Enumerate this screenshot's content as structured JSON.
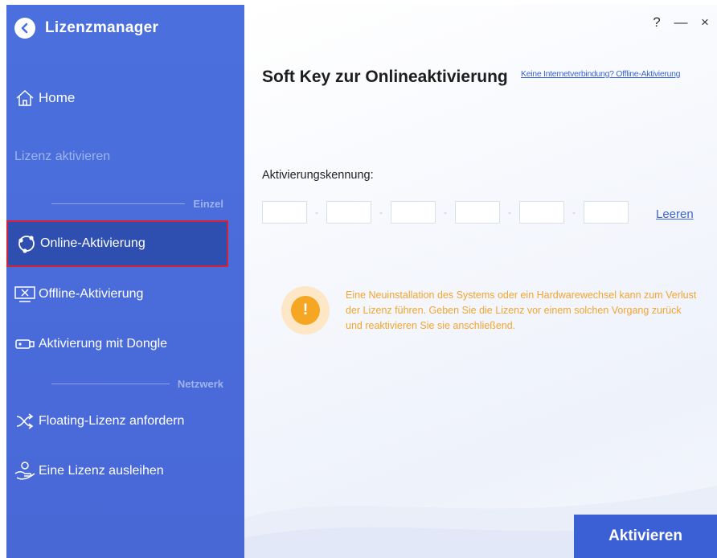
{
  "app": {
    "title": "Lizenzmanager"
  },
  "window_controls": {
    "help": "?",
    "minimize": "—",
    "close": "×"
  },
  "sidebar": {
    "home": "Home",
    "section": "Lizenz aktivieren",
    "group_single": "Einzel",
    "group_network": "Netzwerk",
    "items": [
      {
        "label": "Online-Aktivierung",
        "icon": "online-icon",
        "active": true
      },
      {
        "label": "Offline-Aktivierung",
        "icon": "monitor-x-icon"
      },
      {
        "label": "Aktivierung mit Dongle",
        "icon": "dongle-icon"
      },
      {
        "label": "Floating-Lizenz anfordern",
        "icon": "shuffle-icon"
      },
      {
        "label": "Eine Lizenz ausleihen",
        "icon": "hand-user-icon"
      }
    ]
  },
  "main": {
    "heading": "Soft Key zur Onlineaktivierung",
    "offline_link": "Keine Internetverbindung? Offline-Aktivierung",
    "field_label": "Aktivierungskennung:",
    "key_fields": [
      "",
      "",
      "",
      "",
      "",
      ""
    ],
    "key_separator": "-",
    "clear": "Leeren",
    "warning": "Eine Neuinstallation des Systems oder ein Hardwarewechsel kann zum Verlust der Lizenz führen. Geben Sie die Lizenz vor einem solchen Vorgang zurück und reaktivieren Sie sie anschließend.",
    "warning_icon_glyph": "!",
    "activate": "Aktivieren"
  },
  "colors": {
    "sidebar": "#4a6fdc",
    "active_item": "#2f4fb0",
    "highlight_border": "#d3223a",
    "link": "#3a66d6",
    "warning": "#f5a623",
    "button": "#3b5fd4"
  }
}
